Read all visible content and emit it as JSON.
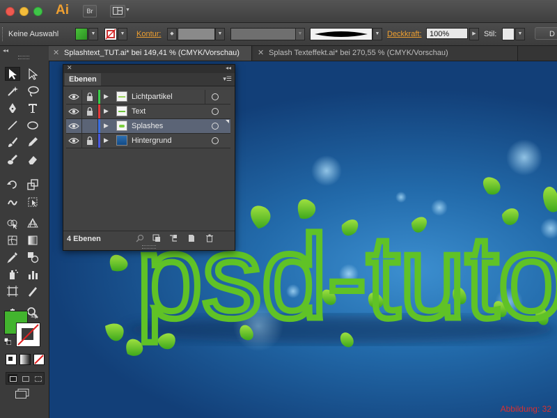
{
  "app": {
    "logo": "Ai",
    "bridge_button": "Br"
  },
  "controlbar": {
    "selection_text": "Keine Auswahl",
    "stroke_label": "Kontur:",
    "opacity_label": "Deckkraft:",
    "opacity_value": "100%",
    "style_label": "Stil:",
    "doc_button": "D",
    "fill_color": "#3fae2a"
  },
  "tabs": [
    {
      "label": "Splashtext_TUT.ai* bei 149,41 % (CMYK/Vorschau)",
      "active": true
    },
    {
      "label": "Splash Texteffekt.ai* bei 270,55 % (CMYK/Vorschau)",
      "active": false
    }
  ],
  "layers_panel": {
    "title": "Ebenen",
    "layers": [
      {
        "name": "Lichtpartikel",
        "color": "#3ccc4a",
        "locked": true,
        "selected": false
      },
      {
        "name": "Text",
        "color": "#e23a3a",
        "locked": true,
        "selected": false
      },
      {
        "name": "Splashes",
        "color": "#3a6ee2",
        "locked": false,
        "selected": true
      },
      {
        "name": "Hintergrund",
        "color": "#4a5ae0",
        "locked": true,
        "selected": false
      }
    ],
    "footer_count": "4 Ebenen"
  },
  "canvas": {
    "artwork_text": "psd-tuto",
    "figure_label": "Abbildung: 32",
    "text_color": "#5ec224"
  },
  "toolbox": {
    "tools": [
      "selection-tool",
      "direct-selection-tool",
      "magic-wand-tool",
      "lasso-tool",
      "pen-tool",
      "type-tool",
      "line-tool",
      "ellipse-tool",
      "paintbrush-tool",
      "pencil-tool",
      "blob-brush-tool",
      "eraser-tool",
      "rotate-tool",
      "scale-tool",
      "warp-tool",
      "free-transform-tool",
      "shape-builder-tool",
      "perspective-grid-tool",
      "mesh-tool",
      "gradient-tool",
      "eyedropper-tool",
      "blend-tool",
      "symbol-sprayer-tool",
      "column-graph-tool",
      "artboard-tool",
      "slice-tool",
      "hand-tool",
      "zoom-tool"
    ]
  }
}
